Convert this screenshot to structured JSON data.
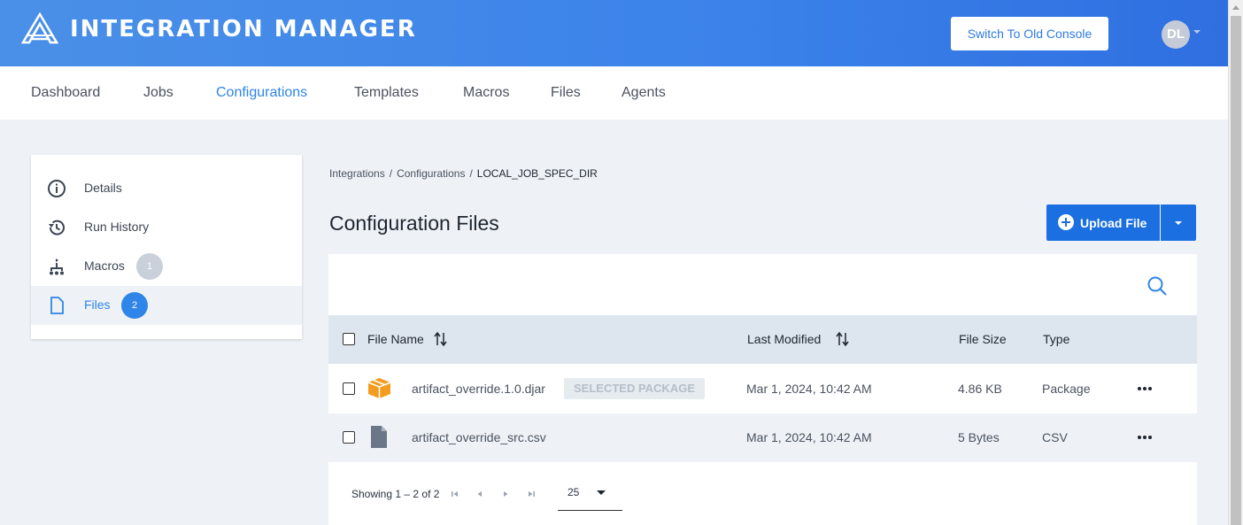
{
  "header": {
    "app_title": "INTEGRATION MANAGER",
    "switch_console_label": "Switch To Old Console",
    "avatar_initials": "DL",
    "brand_color": "#3b82ea"
  },
  "nav": {
    "items": [
      "Dashboard",
      "Jobs",
      "Configurations",
      "Templates",
      "Macros",
      "Files",
      "Agents"
    ],
    "active": "Configurations"
  },
  "sidebar": {
    "items": [
      {
        "label": "Details",
        "icon": "info-icon"
      },
      {
        "label": "Run History",
        "icon": "history-icon"
      },
      {
        "label": "Macros",
        "icon": "macro-icon",
        "badge": "1"
      },
      {
        "label": "Files",
        "icon": "file-icon",
        "badge": "2",
        "active": true
      }
    ]
  },
  "breadcrumb": {
    "items": [
      "Integrations",
      "Configurations",
      "LOCAL_JOB_SPEC_DIR"
    ],
    "separator": "/"
  },
  "page": {
    "title": "Configuration Files",
    "upload_label": "Upload File"
  },
  "table": {
    "columns": [
      "File Name",
      "Last Modified",
      "File Size",
      "Type"
    ],
    "rows": [
      {
        "name": "artifact_override.1.0.djar",
        "tag": "SELECTED PACKAGE",
        "modified": "Mar 1, 2024, 10:42 AM",
        "size": "4.86 KB",
        "type": "Package",
        "icon": "package-icon"
      },
      {
        "name": "artifact_override_src.csv",
        "modified": "Mar 1, 2024, 10:42 AM",
        "size": "5 Bytes",
        "type": "CSV",
        "icon": "document-icon"
      }
    ]
  },
  "pagination": {
    "showing": "Showing 1 – 2 of 2",
    "page_size": "25"
  }
}
